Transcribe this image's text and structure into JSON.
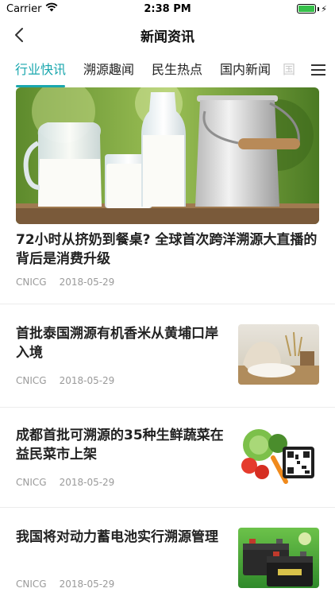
{
  "status_bar": {
    "carrier": "Carrier",
    "time": "2:38 PM",
    "battery_level": 1.0
  },
  "nav": {
    "title": "新闻资讯"
  },
  "tabs": [
    {
      "label": "行业快讯",
      "active": true
    },
    {
      "label": "溯源趣闻",
      "active": false
    },
    {
      "label": "民生热点",
      "active": false
    },
    {
      "label": "国内新闻",
      "active": false
    },
    {
      "label": "国",
      "active": false
    }
  ],
  "feature": {
    "title": "72小时从挤奶到餐桌? 全球首次跨洋溯源大直播的背后是消费升级",
    "source": "CNICG",
    "date": "2018-05-29",
    "image": "milk-jugs-photo"
  },
  "articles": [
    {
      "title": "首批泰国溯源有机香米从黄埔口岸入境",
      "source": "CNICG",
      "date": "2018-05-29",
      "image": "rice-sack-photo"
    },
    {
      "title": "成都首批可溯源的35种生鲜蔬菜在益民菜市上架",
      "source": "CNICG",
      "date": "2018-05-29",
      "image": "vegetables-qr-photo"
    },
    {
      "title": "我国将对动力蓄电池实行溯源管理",
      "source": "CNICG",
      "date": "2018-05-29",
      "image": "battery-photo"
    }
  ],
  "colors": {
    "accent": "#1aa7ae",
    "meta_text": "#9a9a9a"
  }
}
